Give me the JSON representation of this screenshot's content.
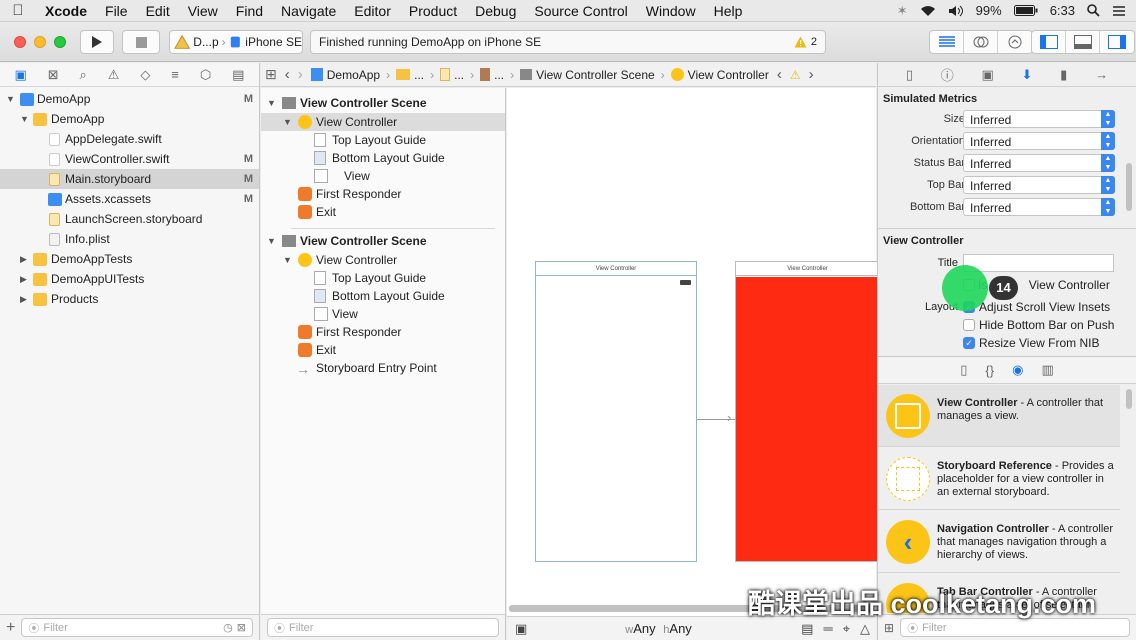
{
  "menubar": {
    "app": "Xcode",
    "items": [
      "File",
      "Edit",
      "View",
      "Find",
      "Navigate",
      "Editor",
      "Product",
      "Debug",
      "Source Control",
      "Window",
      "Help"
    ],
    "battery": "99%",
    "time": "6:33"
  },
  "toolbar": {
    "scheme_app": "D...p",
    "scheme_device": "iPhone SE",
    "activity_text": "Finished running DemoApp on iPhone SE",
    "warning_count": "2"
  },
  "navigator": {
    "items": [
      {
        "label": "DemoApp",
        "badge": "M"
      },
      {
        "label": "DemoApp",
        "badge": ""
      },
      {
        "label": "AppDelegate.swift",
        "badge": ""
      },
      {
        "label": "ViewController.swift",
        "badge": "M"
      },
      {
        "label": "Main.storyboard",
        "badge": "M"
      },
      {
        "label": "Assets.xcassets",
        "badge": "M"
      },
      {
        "label": "LaunchScreen.storyboard",
        "badge": ""
      },
      {
        "label": "Info.plist",
        "badge": ""
      },
      {
        "label": "DemoAppTests",
        "badge": ""
      },
      {
        "label": "DemoAppUITests",
        "badge": ""
      },
      {
        "label": "Products",
        "badge": ""
      }
    ],
    "filter_placeholder": "Filter"
  },
  "jumpbar": {
    "project": "DemoApp",
    "ellipsis1": "...",
    "ellipsis2": "...",
    "ellipsis3": "...",
    "scene": "View Controller Scene",
    "controller": "View Controller"
  },
  "outline": {
    "scene1": {
      "title": "View Controller Scene",
      "items": [
        "View Controller",
        "Top Layout Guide",
        "Bottom Layout Guide",
        "View",
        "First Responder",
        "Exit"
      ]
    },
    "scene2": {
      "title": "View Controller Scene",
      "items": [
        "View Controller",
        "Top Layout Guide",
        "Bottom Layout Guide",
        "View",
        "First Responder",
        "Exit",
        "Storyboard Entry Point"
      ]
    },
    "filter_placeholder": "Filter"
  },
  "canvas": {
    "scene1_title": "View Controller",
    "scene2_title": "View Controller",
    "size_w": "Any",
    "size_h": "Any",
    "size_w_prefix": "w",
    "size_h_prefix": "h",
    "scene2_color": "#ff2a12"
  },
  "inspector": {
    "simulated_metrics": {
      "title": "Simulated Metrics",
      "rows": [
        {
          "label": "Size",
          "value": "Inferred"
        },
        {
          "label": "Orientation",
          "value": "Inferred"
        },
        {
          "label": "Status Bar",
          "value": "Inferred"
        },
        {
          "label": "Top Bar",
          "value": "Inferred"
        },
        {
          "label": "Bottom Bar",
          "value": "Inferred"
        }
      ]
    },
    "view_controller": {
      "title": "View Controller",
      "title_label": "Title",
      "is_initial_label": "Is Initial View Controller",
      "is_initial_partial": "Is In",
      "is_initial_rest": "View Controller",
      "layout_label": "Layout",
      "options": [
        {
          "label": "Adjust Scroll View Insets",
          "checked": true
        },
        {
          "label": "Hide Bottom Bar on Push",
          "checked": false
        },
        {
          "label": "Resize View From NIB",
          "checked": true
        }
      ]
    },
    "touch_badge": "14"
  },
  "library": {
    "items": [
      {
        "name": "View Controller",
        "desc": " - A controller that manages a view."
      },
      {
        "name": "Storyboard Reference",
        "desc": " - Provides a placeholder for a view controller in an external storyboard."
      },
      {
        "name": "Navigation Controller",
        "desc": " - A controller that manages navigation through a hierarchy of views."
      },
      {
        "name": "Tab Bar Controller",
        "desc": " - A controller that manages a set of selectable"
      }
    ],
    "filter_placeholder": "Filter"
  },
  "watermark": "酷课堂出品 coolketang.com",
  "colors": {
    "accent": "#1a73e8",
    "folder": "#f5c242",
    "swift": "#f0632c",
    "storyboard": "#e9a33c"
  }
}
